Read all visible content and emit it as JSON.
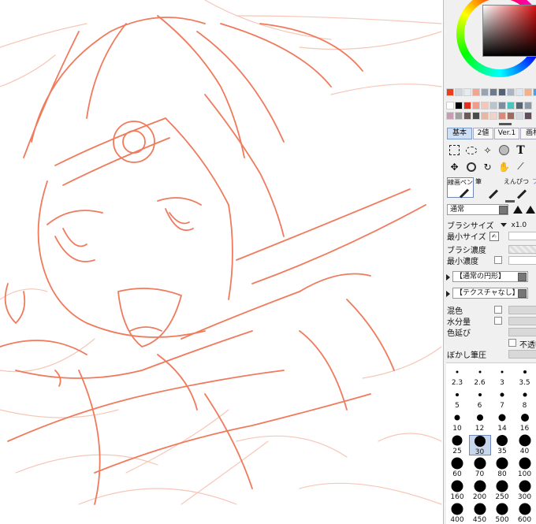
{
  "colors": {
    "sketch_line": "#f07a5c",
    "sketch_faint": "#f6c7b8",
    "panel_bg": "#f0f0f0",
    "accent_selected": "#c9d7ec",
    "current_color": "#c92016"
  },
  "color_picker": {
    "wheel_icon": "color-wheel-icon",
    "square_icon": "color-square-icon"
  },
  "palette": {
    "top_row": [
      "#ea3f1d",
      "#cfd6df",
      "#e6ebf1",
      "#f0a68f",
      "#9aa3b0",
      "#6c7a8c",
      "#566074",
      "#a9b4c4",
      "#dfe5ee",
      "#f3b08a",
      "#4aa0e8"
    ],
    "row2": [
      "#ffffff",
      "#000000",
      "#e0301c",
      "#f29b8a",
      "#f5c7bc",
      "#b9c4cf",
      "#7f8da0",
      "#46c6c0",
      "#5a6472",
      "#8b98a8"
    ],
    "row3": [
      "#c59eb2",
      "#a0a0a0",
      "#6a5a5a",
      "#4a4a4a",
      "#e6b7a5",
      "#f1d2c6",
      "#d98b7a",
      "#9c6b5d",
      "#d4d9e0",
      "#5f4e5a"
    ]
  },
  "tabs": [
    "基本",
    "2値",
    "Ver.1",
    "画材"
  ],
  "tools_row1": [
    "selection-rect-icon",
    "lasso-icon",
    "magic-wand-icon",
    "shape-icon",
    "text-icon"
  ],
  "tools_row2": [
    "move-icon",
    "zoom-icon",
    "rotate-icon",
    "hand-icon",
    "eyedropper-icon"
  ],
  "text_tool_glyph": "T",
  "brush_tabs": [
    "線画ペン",
    "筆",
    "えんぴつ",
    "ブ"
  ],
  "blend_mode": "通常",
  "brush_size": {
    "label": "ブラシサイズ",
    "multiplier": "x1.0"
  },
  "min_size": {
    "label": "最小サイズ"
  },
  "brush_density": {
    "label": "ブラシ濃度"
  },
  "min_density": {
    "label": "最小濃度"
  },
  "shape_select": "【通常の円形】",
  "texture_select": "【テクスチャなし】",
  "mix": {
    "label": "混色"
  },
  "water": {
    "label": "水分量"
  },
  "color_stretch": {
    "label": "色延び"
  },
  "opaque": {
    "label": "不透明"
  },
  "blur_pressure": {
    "label": "ぼかし筆圧"
  },
  "size_grid": [
    {
      "v": "2.3",
      "d": 3
    },
    {
      "v": "2.6",
      "d": 3
    },
    {
      "v": "3",
      "d": 3
    },
    {
      "v": "3.5",
      "d": 4
    },
    {
      "v": "5",
      "d": 4
    },
    {
      "v": "6",
      "d": 4
    },
    {
      "v": "7",
      "d": 5
    },
    {
      "v": "8",
      "d": 5
    },
    {
      "v": "10",
      "d": 7
    },
    {
      "v": "12",
      "d": 8
    },
    {
      "v": "14",
      "d": 9
    },
    {
      "v": "16",
      "d": 10
    },
    {
      "v": "25",
      "d": 13
    },
    {
      "v": "30",
      "d": 14,
      "selected": true
    },
    {
      "v": "35",
      "d": 14
    },
    {
      "v": "40",
      "d": 15
    },
    {
      "v": "60",
      "d": 15
    },
    {
      "v": "70",
      "d": 15
    },
    {
      "v": "80",
      "d": 15
    },
    {
      "v": "100",
      "d": 15
    },
    {
      "v": "160",
      "d": 15
    },
    {
      "v": "200",
      "d": 15
    },
    {
      "v": "250",
      "d": 15
    },
    {
      "v": "300",
      "d": 15
    },
    {
      "v": "400",
      "d": 15
    },
    {
      "v": "450",
      "d": 15
    },
    {
      "v": "500",
      "d": 15
    },
    {
      "v": "600",
      "d": 15
    }
  ]
}
